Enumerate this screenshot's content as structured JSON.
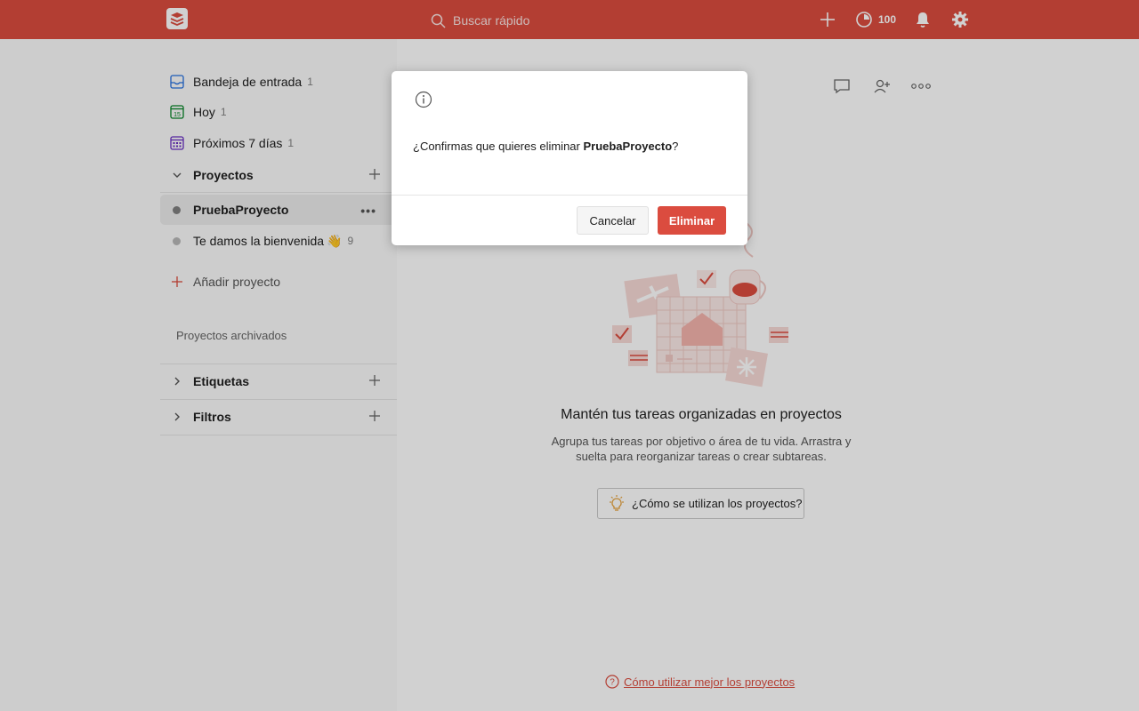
{
  "topbar": {
    "search_placeholder": "Buscar rápido",
    "karma": "100"
  },
  "sidebar": {
    "nav": [
      {
        "label": "Bandeja de entrada",
        "count": "1"
      },
      {
        "label": "Hoy",
        "count": "1"
      },
      {
        "label": "Próximos 7 días",
        "count": "1"
      }
    ],
    "projects_header": "Proyectos",
    "projects": [
      {
        "name": "PruebaProyecto",
        "color": "#808080"
      },
      {
        "name": "Te damos la bienvenida",
        "emoji": "👋",
        "count": "9",
        "color": "#b8b8b8"
      }
    ],
    "add_project": "Añadir proyecto",
    "archived": "Proyectos archivados",
    "labels_header": "Etiquetas",
    "filters_header": "Filtros"
  },
  "main": {
    "empty_title": "Mantén tus tareas organizadas en proyectos",
    "empty_desc": "Agrupa tus tareas por objetivo o área de tu vida. Arrastra y suelta para reorganizar tareas o crear subtareas.",
    "howto_button": "¿Cómo se utilizan los proyectos?",
    "bottom_link": "Cómo utilizar mejor los proyectos"
  },
  "dialog": {
    "message_prefix": "¿Confirmas que quieres eliminar ",
    "project_name": "PruebaProyecto",
    "message_suffix": "?",
    "cancel": "Cancelar",
    "delete": "Eliminar"
  },
  "colors": {
    "brand": "#db4c3f"
  }
}
